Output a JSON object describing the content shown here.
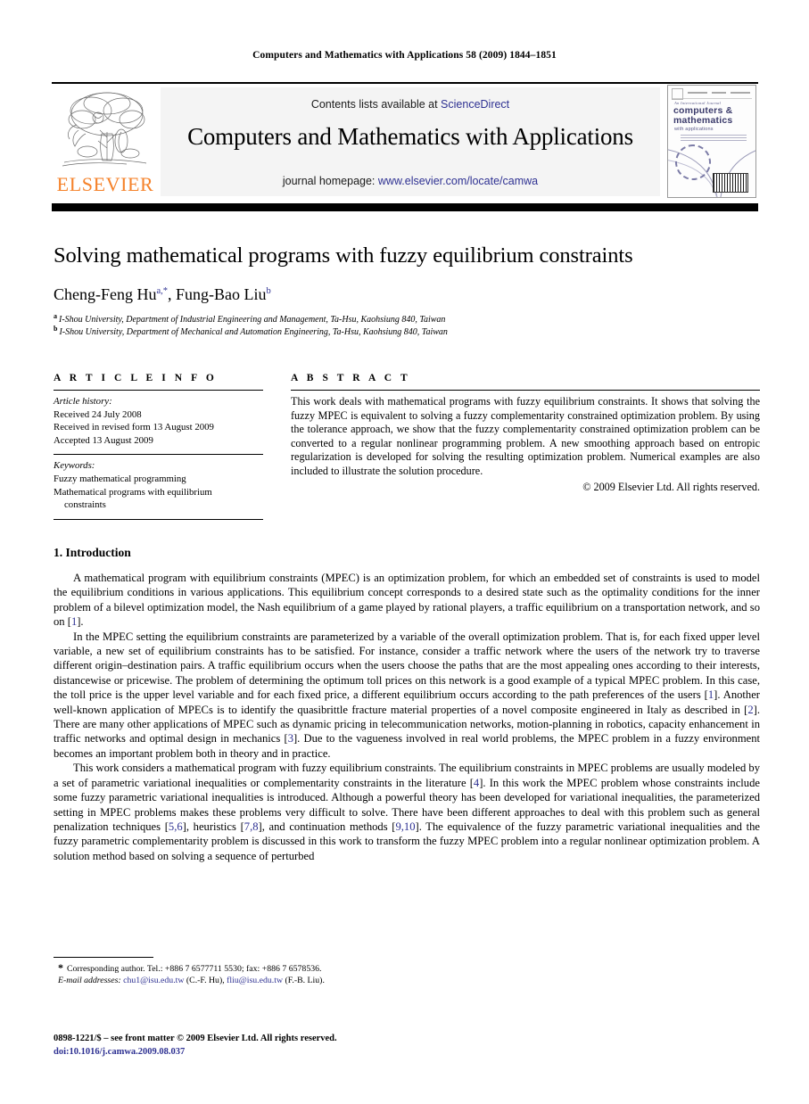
{
  "running_head": "Computers and Mathematics with Applications 58 (2009) 1844–1851",
  "masthead": {
    "contents_prefix": "Contents lists available at ",
    "sciencedirect": "ScienceDirect",
    "journal_title": "Computers and Mathematics with Applications",
    "homepage_prefix": "journal homepage: ",
    "homepage_url": "www.elsevier.com/locate/camwa",
    "publisher_wordmark": "ELSEVIER",
    "cover": {
      "kicker": "An International Journal",
      "title_line1": "computers &",
      "title_line2": "mathematics",
      "subtitle": "with applications"
    },
    "accent_link_color": "#2E3192",
    "publisher_orange": "#F5822A"
  },
  "article": {
    "title": "Solving mathematical programs with fuzzy equilibrium constraints",
    "authors": [
      {
        "name": "Cheng-Feng Hu",
        "marks": "a,*"
      },
      {
        "name": "Fung-Bao Liu",
        "marks": "b"
      }
    ],
    "authors_separator": ", ",
    "affiliations": [
      {
        "mark": "a",
        "text": "I-Shou University, Department of Industrial Engineering and Management, Ta-Hsu, Kaohsiung 840, Taiwan"
      },
      {
        "mark": "b",
        "text": "I-Shou University, Department of Mechanical and Automation Engineering, Ta-Hsu, Kaohsiung 840, Taiwan"
      }
    ]
  },
  "article_info": {
    "heading": "A R T I C L E   I N F O",
    "history_label": "Article history:",
    "history": [
      "Received 24 July 2008",
      "Received in revised form 13 August 2009",
      "Accepted 13 August 2009"
    ],
    "keywords_label": "Keywords:",
    "keywords": [
      "Fuzzy mathematical programming",
      "Mathematical programs with equilibrium",
      "constraints"
    ]
  },
  "abstract": {
    "heading": "A B S T R A C T",
    "text": "This work deals with mathematical programs with fuzzy equilibrium constraints. It shows that solving the fuzzy MPEC is equivalent to solving a fuzzy complementarity constrained optimization problem. By using the tolerance approach, we show that the fuzzy complementarity constrained optimization problem can be converted to a regular nonlinear programming problem. A new smoothing approach based on entropic regularization is developed for solving the resulting optimization problem. Numerical examples are also included to illustrate the solution procedure.",
    "copyright": "© 2009 Elsevier Ltd. All rights reserved."
  },
  "body": {
    "section_number_title": "1.  Introduction",
    "paragraphs": [
      {
        "parts": [
          {
            "t": "A mathematical program with equilibrium constraints (MPEC) is an optimization problem, for which an embedded set of constraints is used to model the equilibrium conditions in various applications. This equilibrium concept corresponds to a desired state such as the optimality conditions for the inner problem of a bilevel optimization model, the Nash equilibrium of a game played by rational players, a traffic equilibrium on a transportation network, and so on ["
          },
          {
            "t": "1",
            "ref": true
          },
          {
            "t": "]."
          }
        ]
      },
      {
        "parts": [
          {
            "t": "In the MPEC setting the equilibrium constraints are parameterized by a variable of the overall optimization problem. That is, for each fixed upper level variable, a new set of equilibrium constraints has to be satisfied. For instance, consider a traffic network where the users of the network try to traverse different origin–destination pairs. A traffic equilibrium occurs when the users choose the paths that are the most appealing ones according to their interests, distancewise or pricewise. The problem of determining the optimum toll prices on this network is a good example of a typical MPEC problem. In this case, the toll price is the upper level variable and for each fixed price, a different equilibrium occurs according to the path preferences of the users ["
          },
          {
            "t": "1",
            "ref": true
          },
          {
            "t": "]. Another well-known application of MPECs is to identify the quasibrittle fracture material properties of a novel composite engineered in Italy as described in ["
          },
          {
            "t": "2",
            "ref": true
          },
          {
            "t": "]. There are many other applications of MPEC such as dynamic pricing in telecommunication networks, motion-planning in robotics, capacity enhancement in traffic networks and optimal design in mechanics ["
          },
          {
            "t": "3",
            "ref": true
          },
          {
            "t": "]. Due to the vagueness involved in real world problems, the MPEC problem in a fuzzy environment becomes an important problem both in theory and in practice."
          }
        ]
      },
      {
        "parts": [
          {
            "t": "This work considers a mathematical program with fuzzy equilibrium constraints. The equilibrium constraints in MPEC problems are usually modeled by a set of parametric variational inequalities or complementarity constraints in the literature ["
          },
          {
            "t": "4",
            "ref": true
          },
          {
            "t": "]. In this work the MPEC problem whose constraints include some fuzzy parametric variational inequalities is introduced. Although a powerful theory has been developed for variational inequalities, the parameterized setting in MPEC problems makes these problems very difficult to solve. There have been different approaches to deal with this problem such as general penalization techniques ["
          },
          {
            "t": "5,6",
            "ref": true
          },
          {
            "t": "], heuristics ["
          },
          {
            "t": "7,8",
            "ref": true
          },
          {
            "t": "], and continuation methods ["
          },
          {
            "t": "9,10",
            "ref": true
          },
          {
            "t": "]. The equivalence of the fuzzy parametric variational inequalities and the fuzzy parametric complementarity problem is discussed in this work to transform the fuzzy MPEC problem into a regular nonlinear optimization problem. A solution method based on solving a sequence of perturbed"
          }
        ]
      }
    ]
  },
  "footnotes": {
    "corresponding_star": "*",
    "corresponding_text": "Corresponding author. Tel.: +886 7 6577711 5530; fax: +886 7 6578536.",
    "email_label": "E-mail addresses:",
    "emails": [
      {
        "address": "chu1@isu.edu.tw",
        "person": "(C.-F. Hu)"
      },
      {
        "address": "fliu@isu.edu.tw",
        "person": "(F.-B. Liu)"
      }
    ]
  },
  "imprint": {
    "line1": "0898-1221/$ – see front matter © 2009 Elsevier Ltd. All rights reserved.",
    "doi": "doi:10.1016/j.camwa.2009.08.037"
  }
}
